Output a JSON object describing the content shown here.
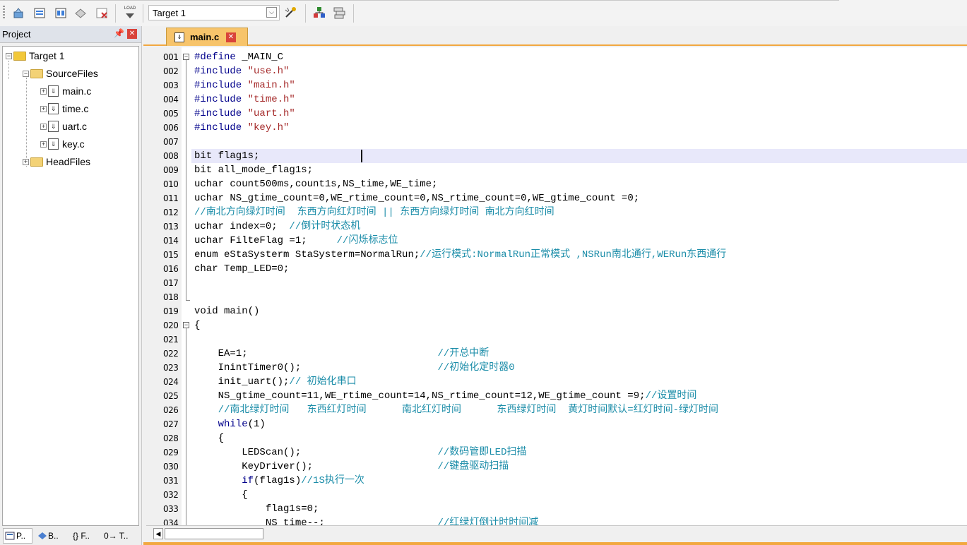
{
  "toolbar": {
    "target_label": "Target 1",
    "load_label": "LOAD",
    "icons": [
      "translate-icon",
      "build-icon",
      "rebuild-icon",
      "batch-build-icon",
      "stop-build-icon",
      "download-icon",
      "target-options-icon",
      "manage-project-icon",
      "select-packs-icon"
    ]
  },
  "project": {
    "title": "Project",
    "tree": {
      "root": "Target 1",
      "groups": [
        {
          "label": "SourceFiles",
          "files": [
            "main.c",
            "time.c",
            "uart.c",
            "key.c"
          ]
        },
        {
          "label": "HeadFiles",
          "files": []
        }
      ]
    },
    "tabs": [
      "P..",
      "B..",
      "{} F..",
      "0→ T.."
    ]
  },
  "editor": {
    "tab_label": "main.c",
    "lines": [
      "001",
      "002",
      "003",
      "004",
      "005",
      "006",
      "007",
      "008",
      "009",
      "010",
      "011",
      "012",
      "013",
      "014",
      "015",
      "016",
      "017",
      "018",
      "019",
      "020",
      "021",
      "022",
      "023",
      "024",
      "025",
      "026",
      "027",
      "028",
      "029",
      "030",
      "031",
      "032",
      "033",
      "034"
    ],
    "code": {
      "l1": {
        "kw": "#define",
        "rest": " _MAIN_C"
      },
      "l2": {
        "kw": "#include",
        "str": "\"use.h\""
      },
      "l3": {
        "kw": "#include",
        "str": "\"main.h\""
      },
      "l4": {
        "kw": "#include",
        "str": "\"time.h\""
      },
      "l5": {
        "kw": "#include",
        "str": "\"uart.h\""
      },
      "l6": {
        "kw": "#include",
        "str": "\"key.h\""
      },
      "l8": "bit flag1s;",
      "l9": "bit all_mode_flag1s;",
      "l10": "uchar count500ms,count1s,NS_time,WE_time;",
      "l11": {
        "a": "uchar NS_gtime_count=",
        "b": "0",
        "c": ",WE_rtime_count=",
        "d": "0",
        "e": ",NS_rtime_count=",
        "f": "0",
        "g": ",WE_gtime_count =",
        "h": "0",
        "i": ";"
      },
      "l12": "//南北方向绿灯时间  东西方向红灯时间 || 东西方向绿灯时间 南北方向红时间",
      "l13": {
        "code": "uchar index=0;  ",
        "comment": "//倒计时状态机"
      },
      "l14": {
        "code": "uchar FilteFlag =1;     ",
        "comment": "//闪烁标志位"
      },
      "l15": {
        "kw": "enum",
        "code": " eStaSysterm StaSysterm=NormalRun;",
        "comment": "//运行模式:NormalRun正常模式 ,NSRun南北通行,WERun东西通行"
      },
      "l16": "char Temp_LED=0;",
      "l19": "void main()",
      "l20": "{",
      "l22": {
        "code": "    EA=1;                                ",
        "comment": "//开总中断"
      },
      "l23": {
        "code": "    InintTimer0();                       ",
        "comment": "//初始化定时器0"
      },
      "l24": {
        "code": "    init_uart();",
        "comment": "// 初始化串口"
      },
      "l25": {
        "code": "    NS_gtime_count=11,WE_rtime_count=14,NS_rtime_count=12,WE_gtime_count =9;",
        "comment": "//设置时间"
      },
      "l26": "    //南北绿灯时间   东西红灯时间      南北红灯时间      东西绿灯时间  黄灯时间默认=红灯时间-绿灯时间",
      "l27": {
        "kw": "    while",
        "code": "(1)"
      },
      "l28": "    {",
      "l29": {
        "code": "        LEDScan();                       ",
        "comment": "//数码管即LED扫描"
      },
      "l30": {
        "code": "        KeyDriver();                     ",
        "comment": "//键盘驱动扫描"
      },
      "l31": {
        "kw": "        if",
        "code": "(flag1s)",
        "comment": "//1S执行一次"
      },
      "l32": "        {",
      "l33": "            flag1s=0;",
      "l34": {
        "code": "            NS_time--;                   ",
        "comment": "//红绿灯倒计时时间减"
      }
    }
  }
}
